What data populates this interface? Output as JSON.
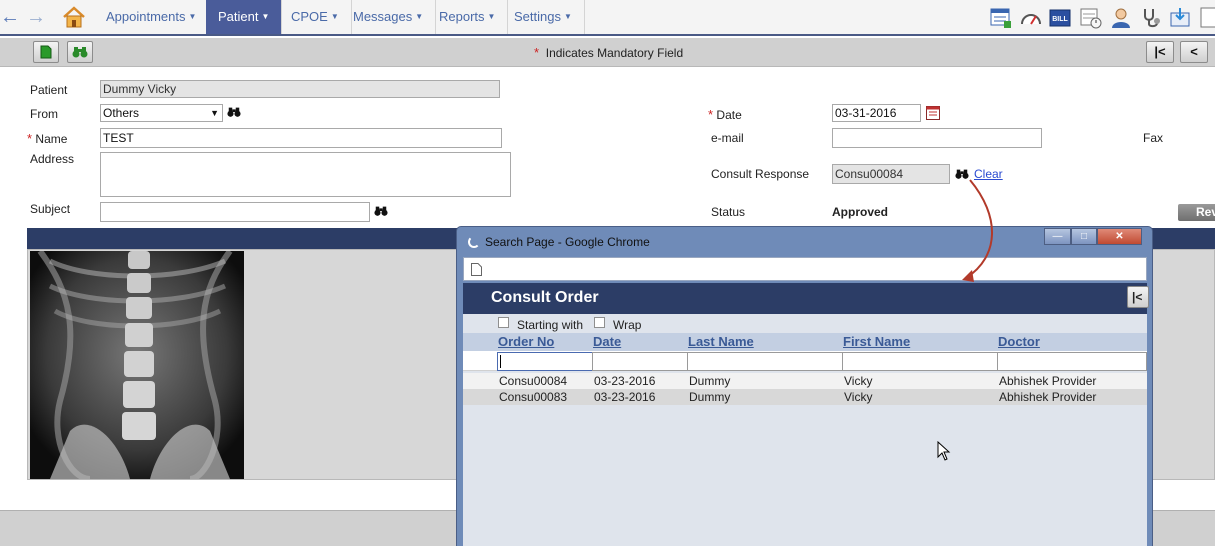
{
  "nav": {
    "items": [
      {
        "label": "Appointments"
      },
      {
        "label": "Patient"
      },
      {
        "label": "CPOE"
      },
      {
        "label": "Messages"
      },
      {
        "label": "Reports"
      },
      {
        "label": "Settings"
      }
    ],
    "active": "Patient",
    "toolbar_icons": [
      "calendar-list-icon",
      "gauge-icon",
      "bill-icon",
      "schedule-icon",
      "user-icon",
      "stethoscope-icon",
      "inbox-icon",
      "document-icon"
    ],
    "bill_badge": "BILL"
  },
  "toolbar": {
    "mandatory_star": "*",
    "mandatory_note": "Indicates Mandatory Field",
    "first_label": "|<",
    "prev_label": "<"
  },
  "form": {
    "patient_label": "Patient",
    "patient_value": "Dummy Vicky",
    "from_label": "From",
    "from_value": "Others",
    "name_label": "Name",
    "name_value": "TEST",
    "address_label": "Address",
    "address_value": "",
    "subject_label": "Subject",
    "subject_value": "",
    "date_label": "Date",
    "date_value": "03-31-2016",
    "email_label": "e-mail",
    "email_value": "",
    "fax_label": "Fax",
    "consult_label": "Consult Response",
    "consult_value": "Consu00084",
    "clear_label": "Clear",
    "status_label": "Status",
    "status_value": "Approved",
    "review_label": "Rev"
  },
  "popup": {
    "window_title": "Search Page - Google Chrome",
    "header_title": "Consult Order",
    "first_label": "|<",
    "starting_with_label": "Starting with",
    "wrap_label": "Wrap",
    "columns": [
      "Order No",
      "Date",
      "Last Name",
      "First Name",
      "Doctor"
    ],
    "rows": [
      [
        "Consu00084",
        "03-23-2016",
        "Dummy",
        "Vicky",
        "Abhishek Provider"
      ],
      [
        "Consu00083",
        "03-23-2016",
        "Dummy",
        "Vicky",
        "Abhishek Provider"
      ]
    ]
  }
}
